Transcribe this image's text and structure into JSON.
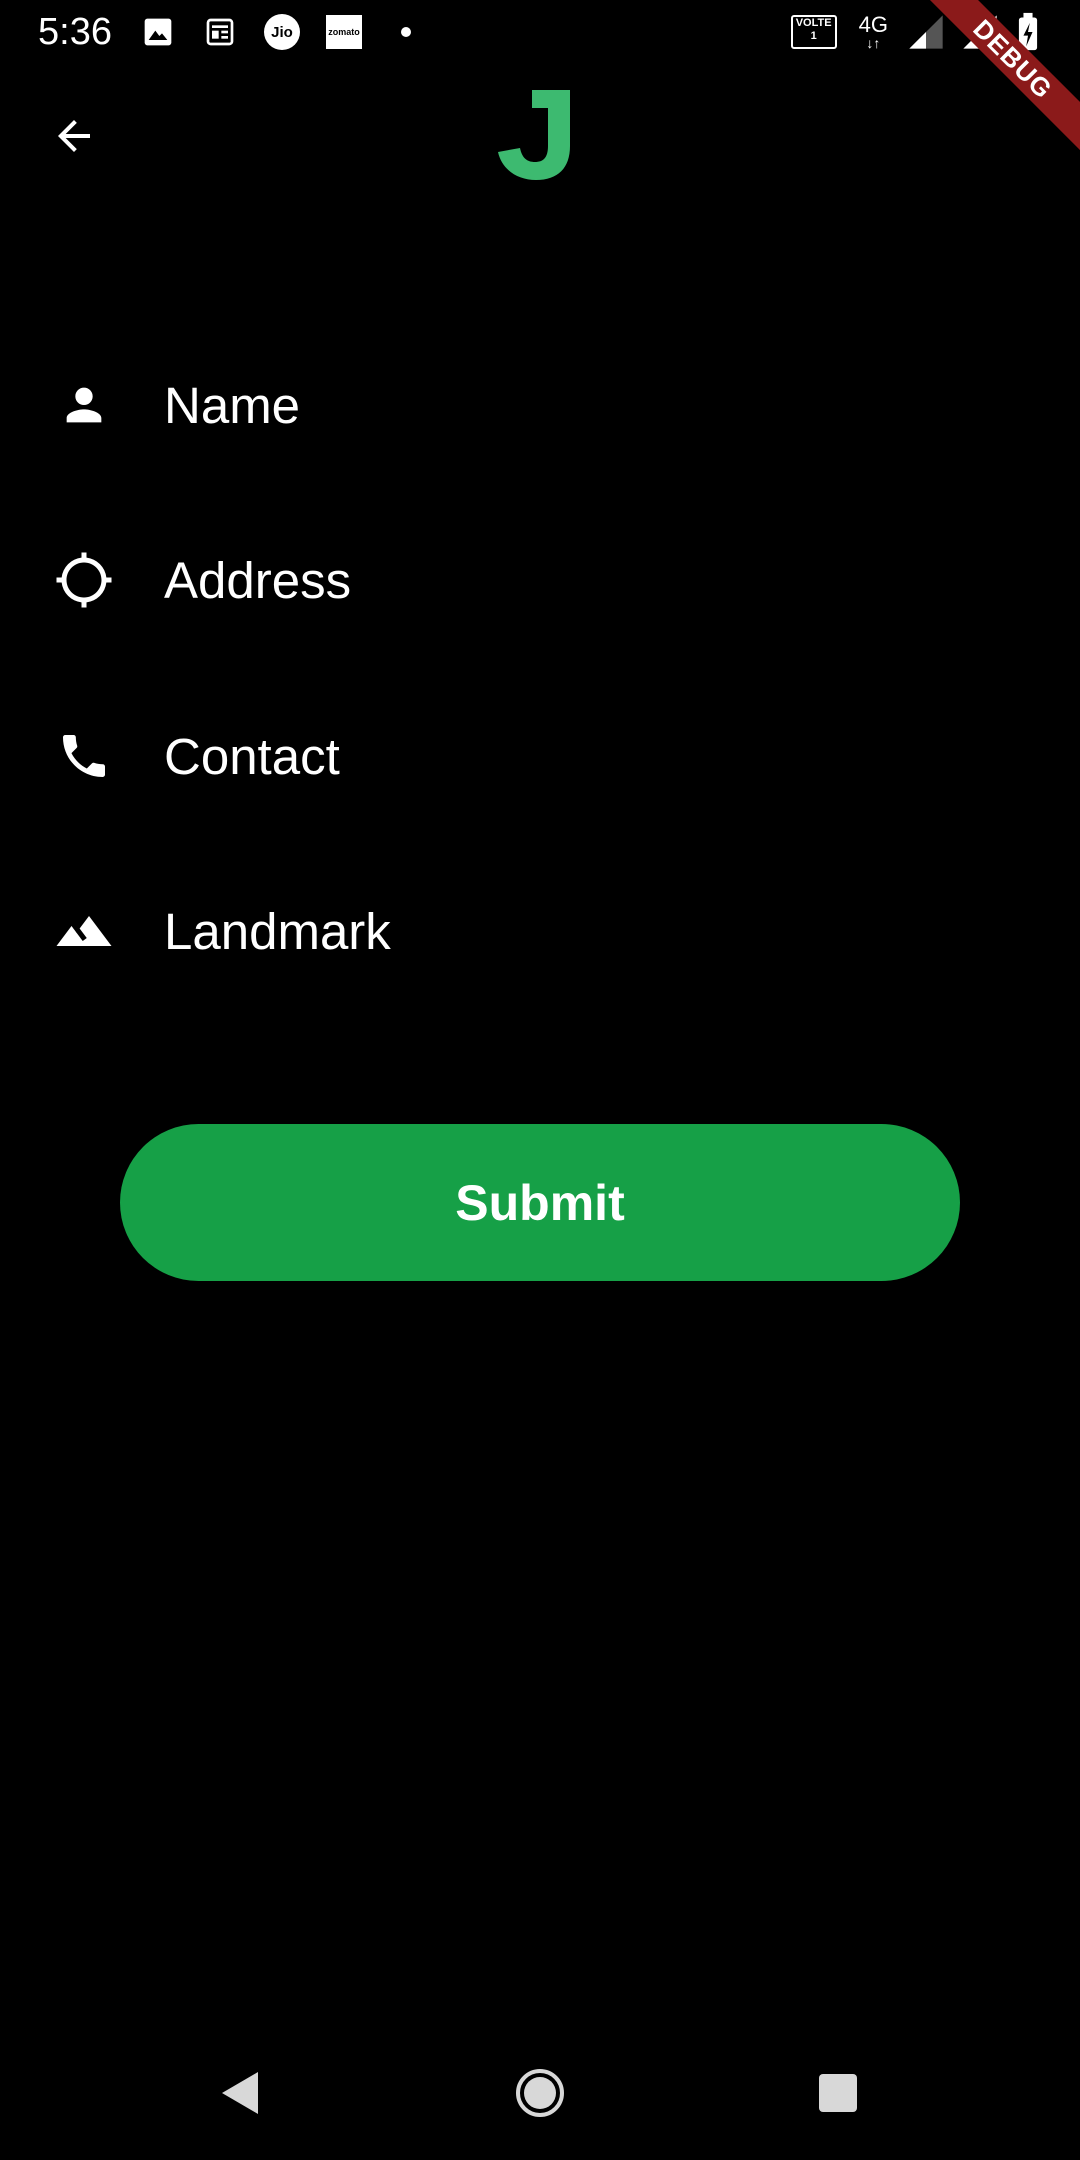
{
  "status_bar": {
    "time": "5:36",
    "jio_label": "Jio",
    "zomato_label": "zomato",
    "volte_label": "VOLTE",
    "volte_sim": "1",
    "network_label": "4G",
    "icons": [
      "gallery-icon",
      "news-icon",
      "jio-icon",
      "zomato-icon",
      "dot-icon",
      "volte-icon",
      "network-4g-icon",
      "signal-icon",
      "signal-icon",
      "battery-charging-icon"
    ]
  },
  "debug_banner": {
    "label": "DEBUG"
  },
  "app_bar": {
    "back_icon": "arrow-back-icon",
    "logo_letter": "J",
    "logo_color": "#3dba70"
  },
  "form": {
    "fields": [
      {
        "label": "Name",
        "icon": "person-icon"
      },
      {
        "label": "Address",
        "icon": "gps-target-icon"
      },
      {
        "label": "Contact",
        "icon": "phone-icon"
      },
      {
        "label": "Landmark",
        "icon": "landscape-icon"
      }
    ],
    "submit_label": "Submit",
    "accent_color": "#16a047"
  },
  "nav_bar": {
    "icons": [
      "back-triangle-icon",
      "home-circle-icon",
      "recents-square-icon"
    ]
  }
}
